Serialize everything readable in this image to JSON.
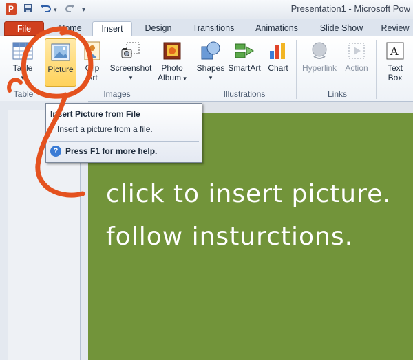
{
  "window": {
    "title": "Presentation1 - Microsoft Pow"
  },
  "app_icon": "P",
  "tabs": [
    {
      "label": "File"
    },
    {
      "label": "Home"
    },
    {
      "label": "Insert"
    },
    {
      "label": "Design"
    },
    {
      "label": "Transitions"
    },
    {
      "label": "Animations"
    },
    {
      "label": "Slide Show"
    },
    {
      "label": "Review"
    }
  ],
  "ribbon": {
    "table": "Table",
    "picture": "Picture",
    "clipart_1": "Clip",
    "clipart_2": "Art",
    "screenshot": "Screenshot",
    "photoalbum_1": "Photo",
    "photoalbum_2": "Album",
    "shapes": "Shapes",
    "smartart": "SmartArt",
    "chart": "Chart",
    "hyperlink": "Hyperlink",
    "action": "Action",
    "textbox_1": "Text",
    "textbox_2": "Box",
    "dropdown_arrow": "▾"
  },
  "groups": {
    "tables": "Table",
    "images": "Images",
    "illustrations": "Illustrations",
    "links": "Links"
  },
  "tooltip": {
    "title": "Insert Picture from File",
    "body": "Insert a picture from a file.",
    "help": "Press F1 for more help.",
    "help_icon_glyph": "?"
  },
  "slide": {
    "line1": "click to insert picture.",
    "line2": "follow insturctions."
  },
  "colors": {
    "slide_bg": "#72943a",
    "annotation": "#e4521f",
    "file_tab": "#d0401f"
  }
}
